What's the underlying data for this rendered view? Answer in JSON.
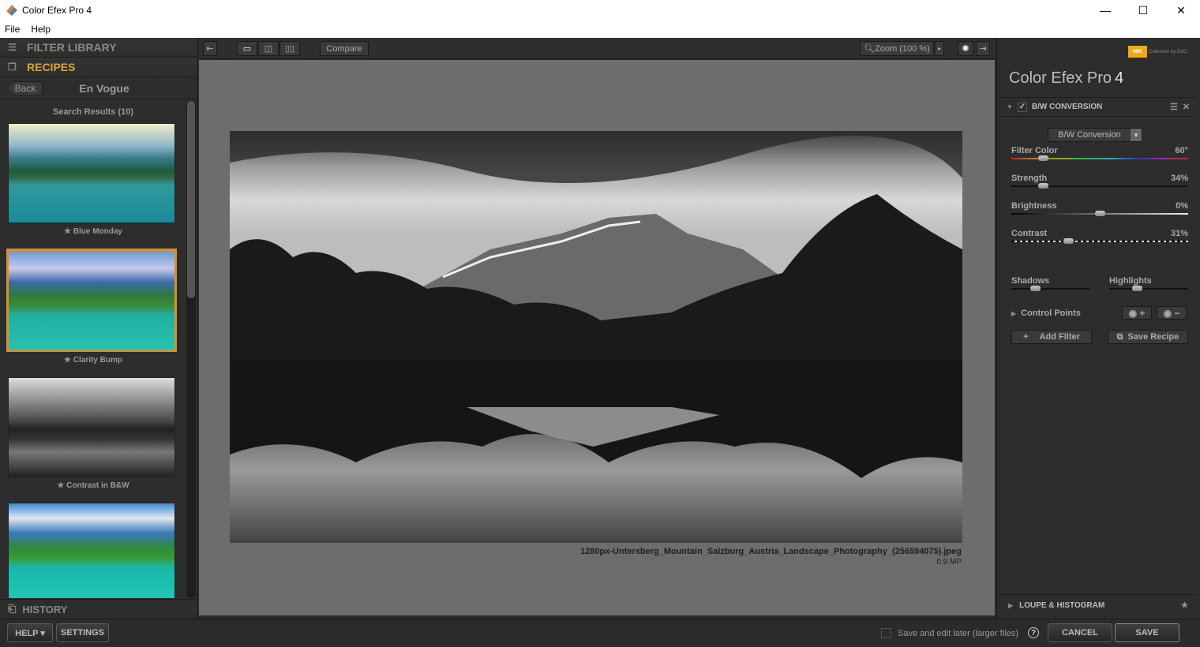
{
  "window": {
    "title": "Color Efex Pro 4",
    "minimize": "—",
    "maximize": "☐",
    "close": "✕"
  },
  "menu": [
    {
      "label": "File"
    },
    {
      "label": "Help"
    }
  ],
  "left_panel": {
    "filter_library": "FILTER LIBRARY",
    "recipes": "RECIPES",
    "back": "Back",
    "category": "En Vogue",
    "search_results": "Search Results (10)",
    "recipes_list": [
      {
        "name": "Blue Monday",
        "selected": false
      },
      {
        "name": "Clarity Bump",
        "selected": true
      },
      {
        "name": "Contrast in B&W",
        "selected": false
      },
      {
        "name": "",
        "selected": false
      }
    ],
    "history": "HISTORY"
  },
  "toolbar": {
    "compare": "Compare",
    "zoom": "Zoom (100 %)"
  },
  "canvas": {
    "filename": "1280px-Untersberg_Mountain_Salzburg_Austria_Landscape_Photography_(256594075).jpeg",
    "megapixels": "0.9 MP"
  },
  "right_panel": {
    "brand": "NIK",
    "brand_suffix": "Collection by DxO",
    "app_title": "Color Efex Pro",
    "app_version": "4",
    "filter_name": "B/W CONVERSION",
    "filter_enabled": true,
    "preset": "B/W Conversion",
    "sliders": [
      {
        "name": "Filter Color",
        "value": "60°",
        "position": 0.18
      },
      {
        "name": "Strength",
        "value": "34%",
        "position": 0.18
      },
      {
        "name": "Brightness",
        "value": "0%",
        "position": 0.5
      },
      {
        "name": "Contrast",
        "value": "31%",
        "position": 0.32
      }
    ],
    "shadows": {
      "label": "Shadows",
      "position": 0.3
    },
    "highlights": {
      "label": "Highlights",
      "position": 0.35
    },
    "control_points": "Control Points",
    "add_filter": "Add Filter",
    "save_recipe": "Save Recipe",
    "loupe": "LOUPE & HISTOGRAM"
  },
  "bottom": {
    "help": "HELP ▾",
    "settings": "SETTINGS",
    "save_later": "Save and edit later (larger files)",
    "cancel": "CANCEL",
    "save": "SAVE"
  }
}
